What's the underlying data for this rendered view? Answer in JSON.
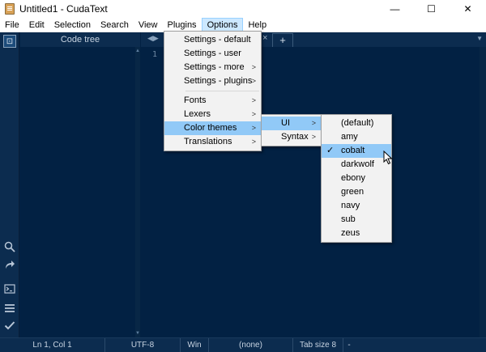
{
  "window": {
    "title": "Untitled1 - CudaText",
    "minimize_glyph": "—",
    "maximize_glyph": "☐",
    "close_glyph": "✕"
  },
  "menubar": [
    "File",
    "Edit",
    "Selection",
    "Search",
    "View",
    "Plugins",
    "Options",
    "Help"
  ],
  "active_menu": "Options",
  "codetree": {
    "header": "Code tree"
  },
  "editor": {
    "line_number": "1",
    "tab_close": "×",
    "tab_add": "+"
  },
  "options_menu": {
    "group1": [
      "Settings - default",
      "Settings - user",
      "Settings - more",
      "Settings - plugins"
    ],
    "group2": [
      "Fonts",
      "Lexers",
      "Color themes",
      "Translations"
    ],
    "submenu_arrows": [
      false,
      false,
      true,
      true,
      true,
      true,
      true,
      true
    ]
  },
  "color_themes_menu": [
    "UI",
    "Syntax"
  ],
  "ui_themes_menu": {
    "items": [
      "(default)",
      "amy",
      "cobalt",
      "darkwolf",
      "ebony",
      "green",
      "navy",
      "sub",
      "zeus"
    ],
    "checked": "cobalt"
  },
  "statusbar": [
    "Ln 1, Col 1",
    "UTF-8",
    "Win",
    "(none)",
    "Tab size 8",
    "-"
  ],
  "colors": {
    "editor_bg": "#022143",
    "panel_bg": "#0c2c4f",
    "menu_highlight": "#91c9f7",
    "menu_bg": "#f2f2f2"
  },
  "icons": {
    "app": "app-icon",
    "codetree_toggle": "codetree-icon",
    "search": "search-icon",
    "goto": "goto-arrow-icon",
    "console": "console-icon",
    "menu": "hamburger-icon",
    "validate": "check-icon"
  }
}
